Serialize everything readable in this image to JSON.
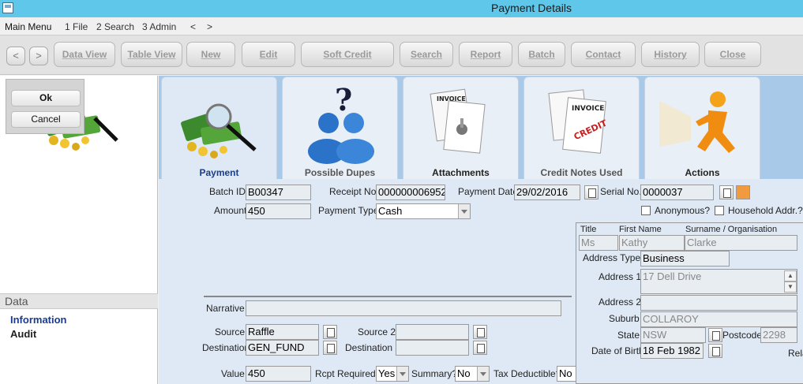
{
  "window": {
    "title": "Payment Details"
  },
  "menu": {
    "items": [
      "Main Menu",
      "1 File",
      "2 Search",
      "3 Admin",
      "<",
      ">"
    ]
  },
  "toolbar": {
    "back": "<",
    "forward": ">",
    "data_view": "Data View",
    "table_view": "Table View",
    "new": "New",
    "edit": "Edit",
    "soft_credit": "Soft Credit",
    "search": "Search",
    "report": "Report",
    "batch": "Batch",
    "contact": "Contact",
    "history": "History",
    "close": "Close"
  },
  "dialog": {
    "ok": "Ok",
    "cancel": "Cancel"
  },
  "sidebar": {
    "section": "Data",
    "items": [
      "Information",
      "Audit"
    ]
  },
  "tabs": [
    "Payment",
    "Possible Dupes",
    "Attachments",
    "Credit Notes Used",
    "Actions"
  ],
  "form": {
    "batch_id_label": "Batch ID",
    "batch_id": "B00347",
    "receipt_no_label": "Receipt No.",
    "receipt_no": "000000006952",
    "payment_date_label": "Payment Date",
    "payment_date": "29/02/2016",
    "serial_no_label": "Serial No.",
    "serial_no": "0000037",
    "amount_label": "Amount",
    "amount": "450",
    "payment_type_label": "Payment Type",
    "payment_type": "Cash",
    "anonymous_label": "Anonymous?",
    "household_label": "Household Addr.?",
    "narrative_label": "Narrative",
    "narrative": "",
    "source_label": "Source",
    "source": "Raffle",
    "source2_label": "Source 2",
    "source2": "",
    "destination_label": "Destination",
    "destination": "GEN_FUND",
    "destination2_label": "Destination 2",
    "destination2": "",
    "value_label": "Value",
    "value": "450",
    "rcpt_required_label": "Rcpt Required?",
    "rcpt_required": "Yes",
    "summary_label": "Summary?",
    "summary": "No",
    "tax_deductible_label": "Tax Deductible?",
    "tax_deductible": "No"
  },
  "contact": {
    "title_label": "Title",
    "title": "Ms",
    "first_name_label": "First Name",
    "first_name": "Kathy",
    "surname_label": "Surname / Organisation",
    "surname": "Clarke",
    "address_type_label": "Address Type",
    "address_type": "Business",
    "address1_label": "Address 1",
    "address1": "17 Dell Drive",
    "address2_label": "Address 2",
    "address2": "",
    "suburb_label": "Suburb",
    "suburb": "COLLAROY",
    "state_label": "State",
    "state": "NSW",
    "postcode_label": "Postcode",
    "postcode": "2298",
    "dob_label": "Date of Birth",
    "dob": "18 Feb 1982",
    "rela_label": "Rela"
  }
}
